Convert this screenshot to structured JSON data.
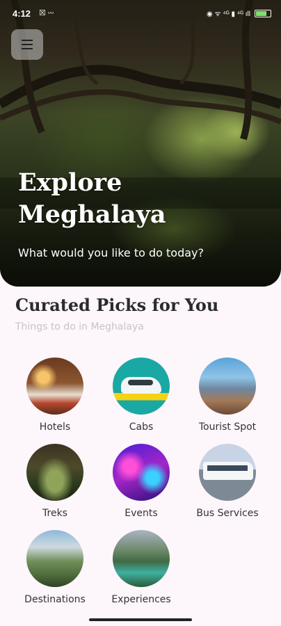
{
  "status_bar": {
    "time": "4:12",
    "left_icons": "☒ ᵕᵕ",
    "right_icons": "◉ ᯤ ⁴ᴳ ▮ ⁴ᴳ ıll"
  },
  "hero": {
    "title": "Explore Meghalaya",
    "subtitle": "What would you like to do today?"
  },
  "section": {
    "title": "Curated Picks for You",
    "subtitle": "Things to do in Meghalaya"
  },
  "categories": [
    {
      "label": "Hotels"
    },
    {
      "label": "Cabs"
    },
    {
      "label": "Tourist Spot"
    },
    {
      "label": "Treks"
    },
    {
      "label": "Events"
    },
    {
      "label": "Bus Services"
    },
    {
      "label": "Destinations"
    },
    {
      "label": "Experiences"
    }
  ]
}
